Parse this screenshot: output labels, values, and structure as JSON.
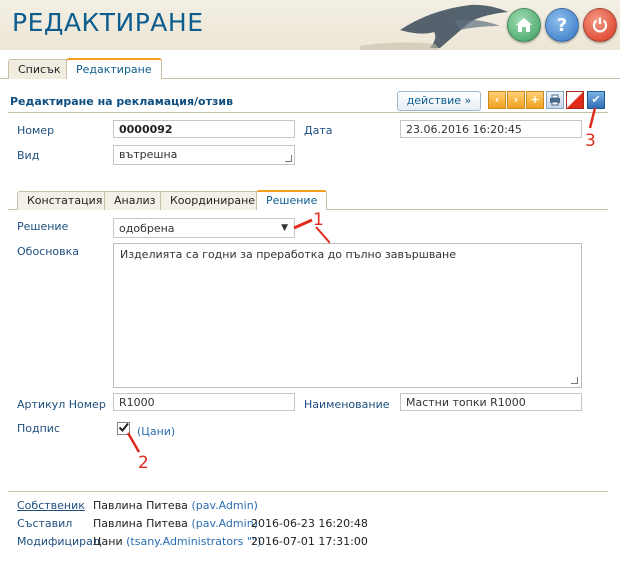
{
  "header": {
    "title": "РЕДАКТИРАНЕ",
    "icons": [
      "home-icon",
      "help-icon",
      "power-icon"
    ],
    "help_symbol": "?"
  },
  "main_tabs": [
    {
      "label": "Списък",
      "active": false
    },
    {
      "label": "Редактиране",
      "active": true
    }
  ],
  "section": {
    "title": "Редактиране на рекламация/отзив",
    "action_button": "действие  »"
  },
  "toolbar": {
    "prev_symbol": "‹",
    "next_symbol": "›",
    "add_symbol": "+",
    "save_symbol": "✔"
  },
  "form": {
    "number_label": "Номер",
    "number_value": "0000092",
    "date_label": "Дата",
    "date_value": "23.06.2016 16:20:45",
    "type_label": "Вид",
    "type_value": "вътрешна"
  },
  "sub_tabs": [
    {
      "label": "Констатация",
      "active": false
    },
    {
      "label": "Анализ",
      "active": false
    },
    {
      "label": "Координиране",
      "active": false
    },
    {
      "label": "Решение",
      "active": true
    }
  ],
  "decision": {
    "label": "Решение",
    "value": "одобрена",
    "reason_label": "Обосновка",
    "reason_value": "Изделията са годни за преработка до пълно завършване",
    "article_label": "Артикул Номер",
    "article_value": "R1000",
    "name_label": "Наименование",
    "name_value": "Мастни топки R1000",
    "sign_label": "Подпис",
    "sign_checked": true,
    "sign_user": "(Цани)"
  },
  "footer": {
    "owner_label": "Собственик",
    "owner_name": "Павлина Питева",
    "owner_user": "(pav.Admin)",
    "created_label": "Съставил",
    "created_name": "Павлина Питева",
    "created_user": "(pav.Admin)",
    "created_time": "2016-06-23 16:20:48",
    "modified_label": "Модифицирал",
    "modified_name": "Цани",
    "modified_user": "(tsany.Administrators \"\")",
    "modified_time": "2016-07-01 17:31:00"
  },
  "annotations": {
    "one": "1",
    "two": "2",
    "three": "3"
  },
  "colors": {
    "accent": "#f0a01e",
    "title": "#0d5e8e",
    "annotation": "#e02b1b"
  }
}
